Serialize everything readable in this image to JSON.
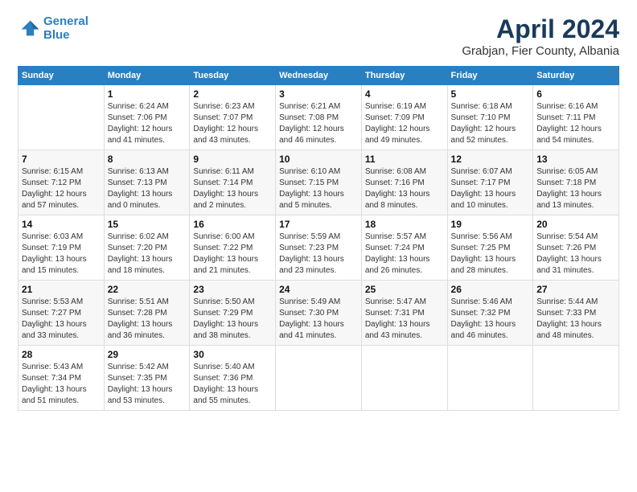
{
  "logo": {
    "line1": "General",
    "line2": "Blue"
  },
  "title": "April 2024",
  "subtitle": "Grabjan, Fier County, Albania",
  "weekdays": [
    "Sunday",
    "Monday",
    "Tuesday",
    "Wednesday",
    "Thursday",
    "Friday",
    "Saturday"
  ],
  "weeks": [
    [
      {
        "day": "",
        "info": ""
      },
      {
        "day": "1",
        "info": "Sunrise: 6:24 AM\nSunset: 7:06 PM\nDaylight: 12 hours\nand 41 minutes."
      },
      {
        "day": "2",
        "info": "Sunrise: 6:23 AM\nSunset: 7:07 PM\nDaylight: 12 hours\nand 43 minutes."
      },
      {
        "day": "3",
        "info": "Sunrise: 6:21 AM\nSunset: 7:08 PM\nDaylight: 12 hours\nand 46 minutes."
      },
      {
        "day": "4",
        "info": "Sunrise: 6:19 AM\nSunset: 7:09 PM\nDaylight: 12 hours\nand 49 minutes."
      },
      {
        "day": "5",
        "info": "Sunrise: 6:18 AM\nSunset: 7:10 PM\nDaylight: 12 hours\nand 52 minutes."
      },
      {
        "day": "6",
        "info": "Sunrise: 6:16 AM\nSunset: 7:11 PM\nDaylight: 12 hours\nand 54 minutes."
      }
    ],
    [
      {
        "day": "7",
        "info": "Sunrise: 6:15 AM\nSunset: 7:12 PM\nDaylight: 12 hours\nand 57 minutes."
      },
      {
        "day": "8",
        "info": "Sunrise: 6:13 AM\nSunset: 7:13 PM\nDaylight: 13 hours\nand 0 minutes."
      },
      {
        "day": "9",
        "info": "Sunrise: 6:11 AM\nSunset: 7:14 PM\nDaylight: 13 hours\nand 2 minutes."
      },
      {
        "day": "10",
        "info": "Sunrise: 6:10 AM\nSunset: 7:15 PM\nDaylight: 13 hours\nand 5 minutes."
      },
      {
        "day": "11",
        "info": "Sunrise: 6:08 AM\nSunset: 7:16 PM\nDaylight: 13 hours\nand 8 minutes."
      },
      {
        "day": "12",
        "info": "Sunrise: 6:07 AM\nSunset: 7:17 PM\nDaylight: 13 hours\nand 10 minutes."
      },
      {
        "day": "13",
        "info": "Sunrise: 6:05 AM\nSunset: 7:18 PM\nDaylight: 13 hours\nand 13 minutes."
      }
    ],
    [
      {
        "day": "14",
        "info": "Sunrise: 6:03 AM\nSunset: 7:19 PM\nDaylight: 13 hours\nand 15 minutes."
      },
      {
        "day": "15",
        "info": "Sunrise: 6:02 AM\nSunset: 7:20 PM\nDaylight: 13 hours\nand 18 minutes."
      },
      {
        "day": "16",
        "info": "Sunrise: 6:00 AM\nSunset: 7:22 PM\nDaylight: 13 hours\nand 21 minutes."
      },
      {
        "day": "17",
        "info": "Sunrise: 5:59 AM\nSunset: 7:23 PM\nDaylight: 13 hours\nand 23 minutes."
      },
      {
        "day": "18",
        "info": "Sunrise: 5:57 AM\nSunset: 7:24 PM\nDaylight: 13 hours\nand 26 minutes."
      },
      {
        "day": "19",
        "info": "Sunrise: 5:56 AM\nSunset: 7:25 PM\nDaylight: 13 hours\nand 28 minutes."
      },
      {
        "day": "20",
        "info": "Sunrise: 5:54 AM\nSunset: 7:26 PM\nDaylight: 13 hours\nand 31 minutes."
      }
    ],
    [
      {
        "day": "21",
        "info": "Sunrise: 5:53 AM\nSunset: 7:27 PM\nDaylight: 13 hours\nand 33 minutes."
      },
      {
        "day": "22",
        "info": "Sunrise: 5:51 AM\nSunset: 7:28 PM\nDaylight: 13 hours\nand 36 minutes."
      },
      {
        "day": "23",
        "info": "Sunrise: 5:50 AM\nSunset: 7:29 PM\nDaylight: 13 hours\nand 38 minutes."
      },
      {
        "day": "24",
        "info": "Sunrise: 5:49 AM\nSunset: 7:30 PM\nDaylight: 13 hours\nand 41 minutes."
      },
      {
        "day": "25",
        "info": "Sunrise: 5:47 AM\nSunset: 7:31 PM\nDaylight: 13 hours\nand 43 minutes."
      },
      {
        "day": "26",
        "info": "Sunrise: 5:46 AM\nSunset: 7:32 PM\nDaylight: 13 hours\nand 46 minutes."
      },
      {
        "day": "27",
        "info": "Sunrise: 5:44 AM\nSunset: 7:33 PM\nDaylight: 13 hours\nand 48 minutes."
      }
    ],
    [
      {
        "day": "28",
        "info": "Sunrise: 5:43 AM\nSunset: 7:34 PM\nDaylight: 13 hours\nand 51 minutes."
      },
      {
        "day": "29",
        "info": "Sunrise: 5:42 AM\nSunset: 7:35 PM\nDaylight: 13 hours\nand 53 minutes."
      },
      {
        "day": "30",
        "info": "Sunrise: 5:40 AM\nSunset: 7:36 PM\nDaylight: 13 hours\nand 55 minutes."
      },
      {
        "day": "",
        "info": ""
      },
      {
        "day": "",
        "info": ""
      },
      {
        "day": "",
        "info": ""
      },
      {
        "day": "",
        "info": ""
      }
    ]
  ]
}
